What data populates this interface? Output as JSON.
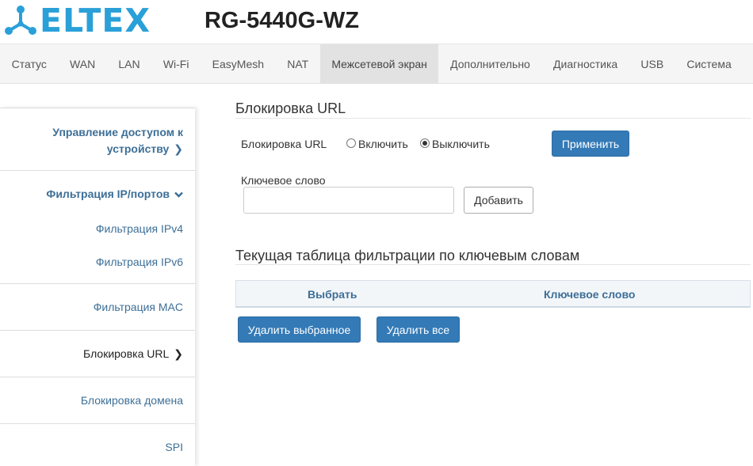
{
  "header": {
    "brand": "ELTEX",
    "model": "RG-5440G-WZ",
    "brand_color": "#2aa0d8"
  },
  "topnav": {
    "items": [
      "Статус",
      "WAN",
      "LAN",
      "Wi-Fi",
      "EasyMesh",
      "NAT",
      "Межсетевой экран",
      "Дополнительно",
      "Диагностика",
      "USB",
      "Система"
    ],
    "active": "Межсетевой экран"
  },
  "sidebar": {
    "access_control_line1": "Управление доступом к",
    "access_control_line2": "устройству",
    "ip_port_filter": "Фильтрация IP/портов",
    "ipv4_filter": "Фильтрация IPv4",
    "ipv6_filter": "Фильтрация IPv6",
    "mac_filter": "Фильтрация MAC",
    "url_block": "Блокировка URL",
    "domain_block": "Блокировка домена",
    "spi": "SPI",
    "icons": {
      "chevron_right": "chevron-right-icon",
      "chevron_down": "chevron-down-icon"
    }
  },
  "main": {
    "title": "Блокировка URL",
    "url_block_label": "Блокировка URL",
    "radio_on_label": "Включить",
    "radio_off_label": "Выключить",
    "selected": "off",
    "apply_label": "Применить",
    "keyword_label": "Ключевое слово",
    "keyword_value": "",
    "add_label": "Добавить",
    "table_title": "Текущая таблица фильтрации по ключевым словам",
    "table_columns": [
      "Выбрать",
      "Ключевое слово"
    ],
    "table_rows": [],
    "delete_selected_label": "Удалить выбранное",
    "delete_all_label": "Удалить все"
  },
  "colors": {
    "primary": "#337ab7",
    "link": "#3d6f97",
    "nav_active_bg": "#e2e2e2"
  }
}
